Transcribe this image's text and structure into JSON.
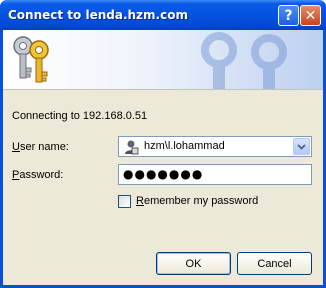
{
  "window": {
    "title": "Connect to lenda.hzm.com",
    "help_glyph": "?",
    "close_glyph": "✕"
  },
  "icons": {
    "banner": "keys-icon",
    "user": "user-account-icon",
    "dropdown": "chevron-down-icon"
  },
  "colors": {
    "titlebar": "#0553e2",
    "client_bg": "#ece9d8",
    "close_button": "#c9431c"
  },
  "form": {
    "connecting_text": "Connecting to 192.168.0.51",
    "user_label_accel": "U",
    "user_label_rest": "ser name:",
    "username_value": "hzm\\l.lohammad",
    "password_label_accel": "P",
    "password_label_rest": "assword:",
    "password_mask": "●●●●●●●",
    "remember_accel": "R",
    "remember_rest": "emember my password",
    "remember_checked": false
  },
  "buttons": {
    "ok": "OK",
    "cancel": "Cancel"
  }
}
